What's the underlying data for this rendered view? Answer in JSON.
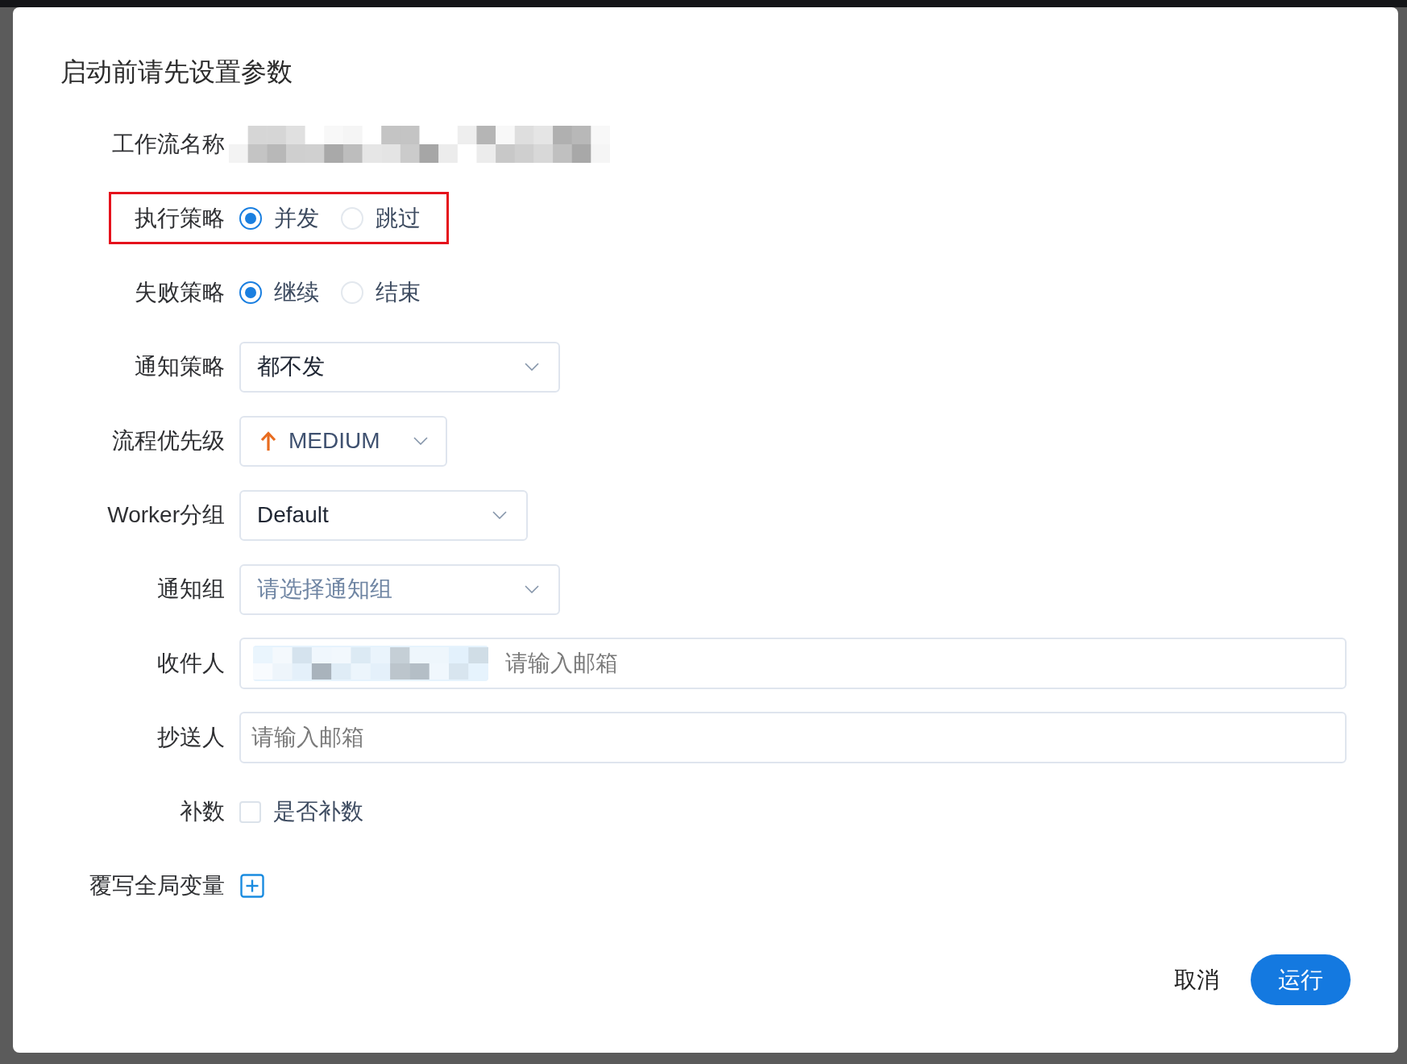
{
  "dialog": {
    "title": "启动前请先设置参数"
  },
  "fields": [
    {
      "kind": "redacted",
      "label": "工作流名称",
      "highlighted": false
    },
    {
      "kind": "radio",
      "label": "执行策略",
      "highlighted": true,
      "options": [
        {
          "label": "并发",
          "selected": true
        },
        {
          "label": "跳过",
          "selected": false
        }
      ]
    },
    {
      "kind": "radio",
      "label": "失败策略",
      "highlighted": false,
      "options": [
        {
          "label": "继续",
          "selected": true
        },
        {
          "label": "结束",
          "selected": false
        }
      ]
    },
    {
      "kind": "select",
      "label": "通知策略",
      "highlighted": false,
      "value": "都不发"
    },
    {
      "kind": "priority",
      "label": "流程优先级",
      "highlighted": false,
      "value": "MEDIUM"
    },
    {
      "kind": "select",
      "label": "Worker分组",
      "highlighted": false,
      "value": "Default"
    },
    {
      "kind": "select",
      "label": "通知组",
      "highlighted": false,
      "placeholder": "请选择通知组"
    },
    {
      "kind": "email",
      "label": "收件人",
      "highlighted": false,
      "tag_redacted": true,
      "placeholder": "请输入邮箱"
    },
    {
      "kind": "email",
      "label": "抄送人",
      "highlighted": false,
      "tag_redacted": false,
      "placeholder": "请输入邮箱"
    },
    {
      "kind": "checkbox",
      "label": "补数",
      "highlighted": false,
      "option": "是否补数",
      "checked": false
    },
    {
      "kind": "add",
      "label": "覆写全局变量",
      "highlighted": false
    }
  ],
  "buttons": [
    {
      "kind": "text",
      "label": "取消"
    },
    {
      "kind": "primary",
      "label": "运行"
    }
  ]
}
